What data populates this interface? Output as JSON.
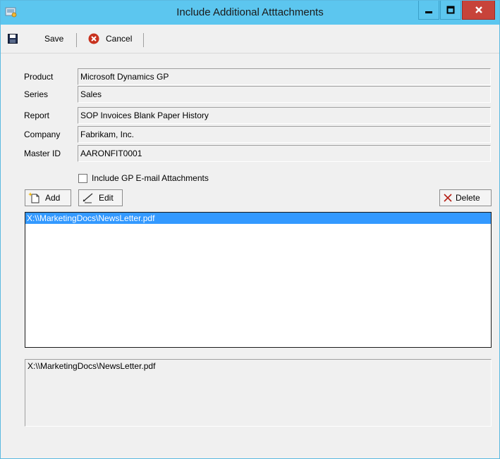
{
  "window": {
    "title": "Include Additional Atttachments",
    "controls": {
      "minimize": "‒",
      "maximize": "☐",
      "close": "x"
    }
  },
  "toolbar": {
    "save_label": "Save",
    "cancel_label": "Cancel"
  },
  "fields": [
    {
      "label": "Product",
      "value": "Microsoft Dynamics GP"
    },
    {
      "label": "Series",
      "value": "Sales"
    },
    {
      "label": "Report",
      "value": "SOP Invoices Blank Paper History"
    },
    {
      "label": "Company",
      "value": "Fabrikam, Inc."
    },
    {
      "label": "Master ID",
      "value": "AARONFIT0001"
    }
  ],
  "include_gp_attachments": {
    "label": "Include GP E-mail Attachments",
    "checked": false
  },
  "actions": {
    "add_label": "Add",
    "edit_label": "Edit",
    "delete_label": "Delete"
  },
  "attachments": {
    "items": [
      "X:\\\\MarketingDocs\\NewsLetter.pdf"
    ],
    "selected_index": 0
  },
  "preview": {
    "text": "X:\\\\MarketingDocs\\NewsLetter.pdf"
  },
  "colors": {
    "titlebar": "#5cc6ef",
    "close_button": "#c7433a",
    "selection": "#3399ff"
  }
}
